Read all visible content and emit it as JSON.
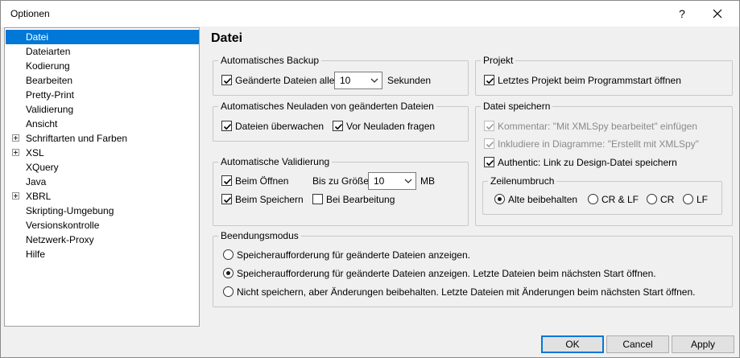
{
  "window": {
    "title": "Optionen",
    "help_label": "?"
  },
  "sidebar": {
    "items": [
      {
        "label": "Datei",
        "selected": true,
        "expandable": false
      },
      {
        "label": "Dateiarten",
        "selected": false,
        "expandable": false
      },
      {
        "label": "Kodierung",
        "selected": false,
        "expandable": false
      },
      {
        "label": "Bearbeiten",
        "selected": false,
        "expandable": false
      },
      {
        "label": "Pretty-Print",
        "selected": false,
        "expandable": false
      },
      {
        "label": "Validierung",
        "selected": false,
        "expandable": false
      },
      {
        "label": "Ansicht",
        "selected": false,
        "expandable": false
      },
      {
        "label": "Schriftarten und Farben",
        "selected": false,
        "expandable": true
      },
      {
        "label": "XSL",
        "selected": false,
        "expandable": true
      },
      {
        "label": "XQuery",
        "selected": false,
        "expandable": false
      },
      {
        "label": "Java",
        "selected": false,
        "expandable": false
      },
      {
        "label": "XBRL",
        "selected": false,
        "expandable": true
      },
      {
        "label": "Skripting-Umgebung",
        "selected": false,
        "expandable": false
      },
      {
        "label": "Versionskontrolle",
        "selected": false,
        "expandable": false
      },
      {
        "label": "Netzwerk-Proxy",
        "selected": false,
        "expandable": false
      },
      {
        "label": "Hilfe",
        "selected": false,
        "expandable": false
      }
    ]
  },
  "main": {
    "title": "Datei",
    "backup": {
      "label": "Automatisches Backup",
      "changed_files_label": "Geänderte Dateien alle",
      "changed_files_checked": true,
      "interval_value": "10",
      "seconds_label": "Sekunden"
    },
    "reload": {
      "label": "Automatisches Neuladen von geänderten Dateien",
      "watch_label": "Dateien überwachen",
      "watch_checked": true,
      "ask_label": "Vor Neuladen fragen",
      "ask_checked": true
    },
    "validation": {
      "label": "Automatische Validierung",
      "on_open_label": "Beim Öffnen",
      "on_open_checked": true,
      "size_label": "Bis zu Größe",
      "size_value": "10",
      "size_unit": "MB",
      "on_save_label": "Beim Speichern",
      "on_save_checked": true,
      "on_edit_label": "Bei Bearbeitung",
      "on_edit_checked": false
    },
    "project": {
      "label": "Projekt",
      "open_last_label": "Letztes Projekt beim Programmstart öffnen",
      "open_last_checked": true
    },
    "save": {
      "label": "Datei speichern",
      "comment_label": "Kommentar: \"Mit XMLSpy bearbeitet\" einfügen",
      "include_label": "Inkludiere in Diagramme: \"Erstellt mit XMLSpy\"",
      "authentic_label": "Authentic: Link zu Design-Datei speichern",
      "authentic_checked": true,
      "linebreak": {
        "label": "Zeilenumbruch",
        "options": [
          "Alte beibehalten",
          "CR & LF",
          "CR",
          "LF"
        ],
        "selected": 0
      }
    },
    "exit": {
      "label": "Beendungsmodus",
      "options": [
        "Speicheraufforderung für geänderte Dateien anzeigen.",
        "Speicheraufforderung für geänderte Dateien anzeigen. Letzte Dateien beim nächsten Start öffnen.",
        "Nicht speichern, aber Änderungen beibehalten. Letzte Dateien mit Änderungen beim nächsten Start öffnen."
      ],
      "selected": 1
    }
  },
  "footer": {
    "ok_label": "OK",
    "cancel_label": "Cancel",
    "apply_label": "Apply"
  }
}
